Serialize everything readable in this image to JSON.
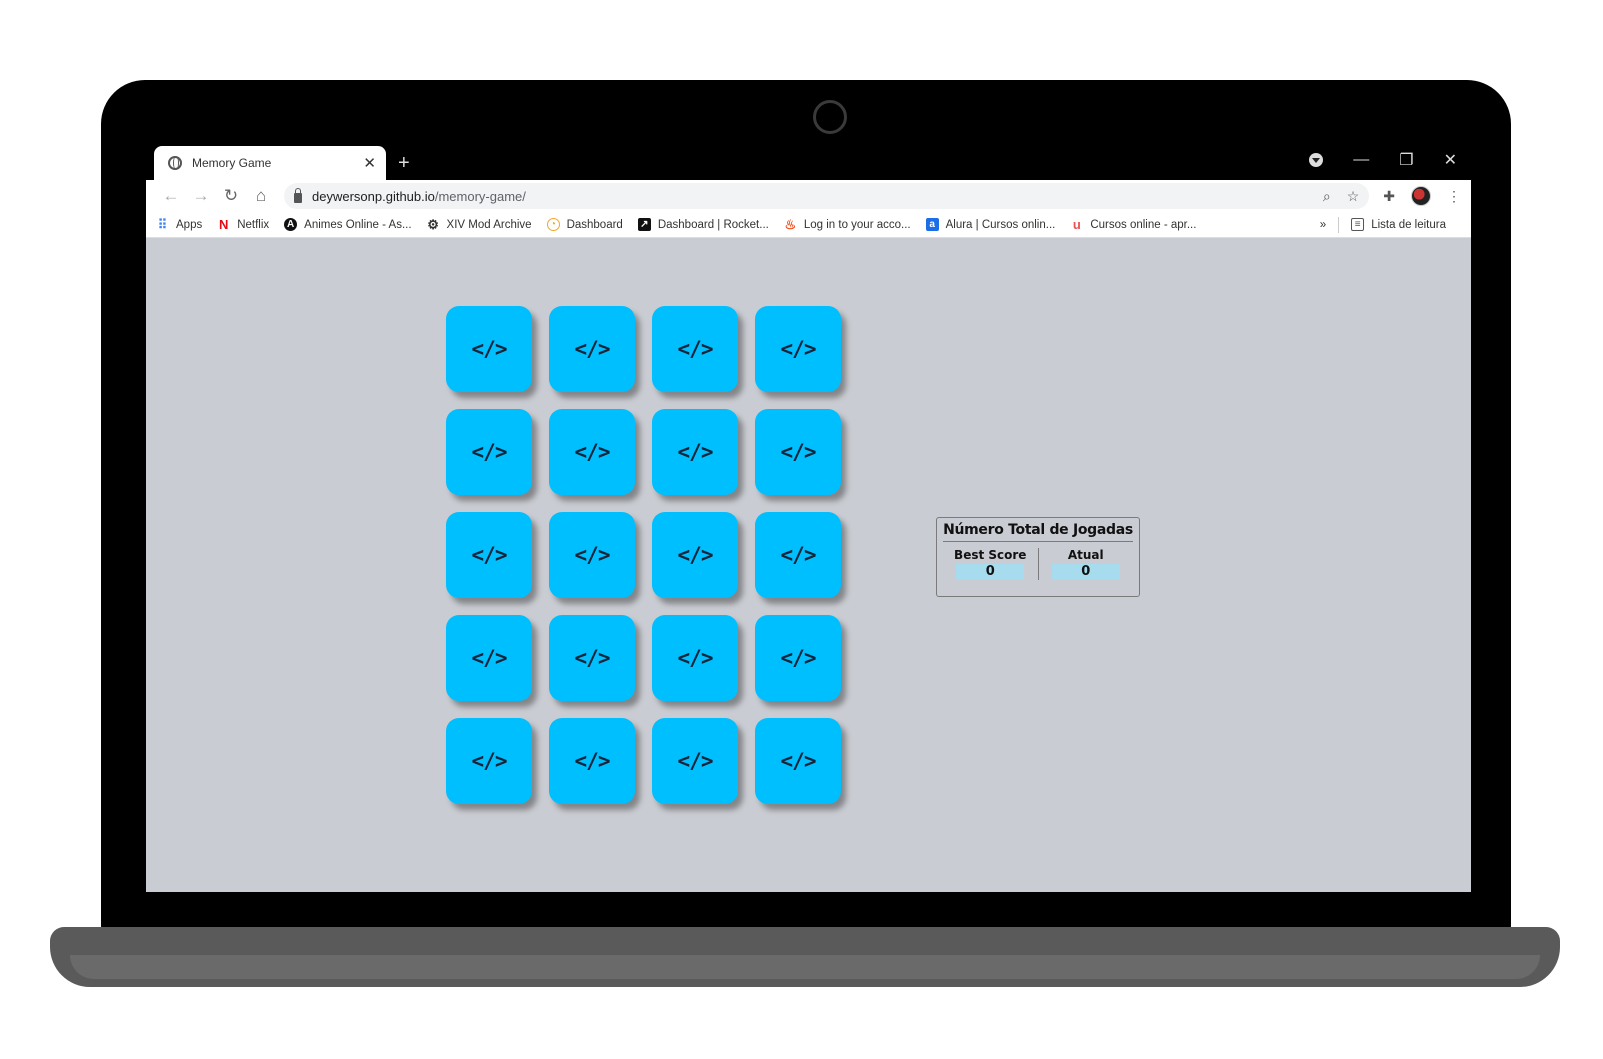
{
  "window": {
    "tab_title": "Memory Game",
    "tab_close": "✕",
    "new_tab": "+",
    "minimize": "—",
    "restore": "❐",
    "close": "✕"
  },
  "toolbar": {
    "back": "←",
    "forward": "→",
    "reload": "↻",
    "home": "⌂",
    "url_host": "deywersonp.github.io",
    "url_path": "/memory-game/",
    "zoom_icon": "⌕",
    "star_icon": "☆",
    "extensions_icon": "✚",
    "menu_icon": "⋮"
  },
  "bookmarks": {
    "items": [
      {
        "label": "Apps",
        "icon": "apps-grid-icon",
        "color": "#4285f4"
      },
      {
        "label": "Netflix",
        "icon": "netflix-icon",
        "color": "#e50914"
      },
      {
        "label": "Animes Online - As...",
        "icon": "animes-icon",
        "color": "#111111"
      },
      {
        "label": "XIV Mod Archive",
        "icon": "xiv-icon",
        "color": "#333333"
      },
      {
        "label": "Dashboard",
        "icon": "dashboard-icon",
        "color": "#f5a623"
      },
      {
        "label": "Dashboard | Rocket...",
        "icon": "rocket-icon",
        "color": "#111111"
      },
      {
        "label": "Log in to your acco...",
        "icon": "flame-icon",
        "color": "#f24e1e"
      },
      {
        "label": "Alura | Cursos onlin...",
        "icon": "alura-icon",
        "color": "#1c6ee8"
      },
      {
        "label": "Cursos online - apr...",
        "icon": "udemy-icon",
        "color": "#ec5252"
      }
    ],
    "overflow": "»",
    "reading_list": "Lista de leitura"
  },
  "game": {
    "card_icon": "</>",
    "card_count": 20,
    "card_color": "#00bfff"
  },
  "score": {
    "title": "Número Total de Jogadas",
    "best_label": "Best Score",
    "best_value": "0",
    "current_label": "Atual",
    "current_value": "0"
  }
}
